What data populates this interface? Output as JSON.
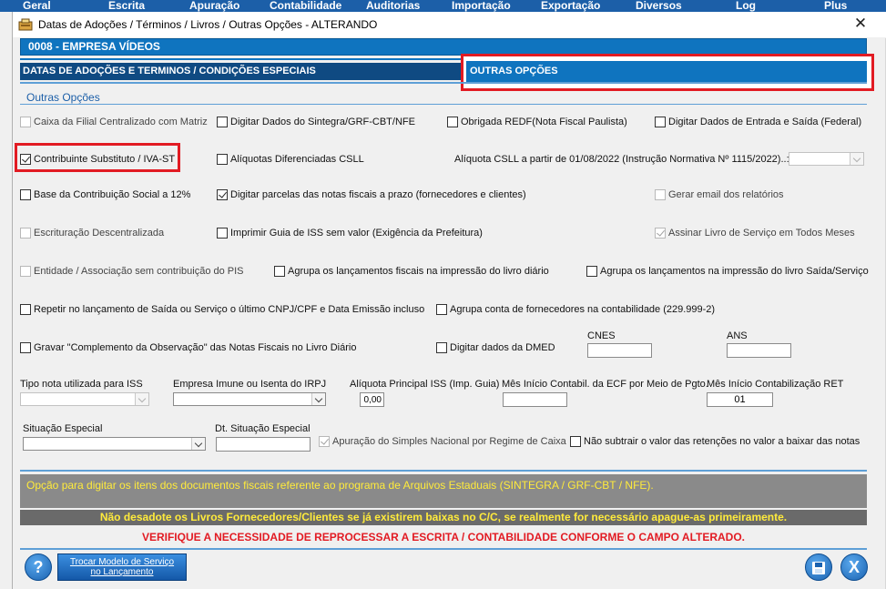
{
  "menu": [
    "Geral",
    "Escrita",
    "Apuração",
    "Contabilidade",
    "Auditorias",
    "Importação",
    "Exportação",
    "Diversos",
    "Log",
    "Plus"
  ],
  "window": {
    "title": "Datas de Adoções / Términos / Livros / Outras Opções   -   ALTERANDO",
    "close": "✕"
  },
  "company": "0008   -   EMPRESA VÍDEOS",
  "tabs": {
    "left": "DATAS DE ADOÇÕES E TERMINOS / CONDIÇÕES ESPECIAIS",
    "right": "OUTRAS OPÇÕES"
  },
  "section_title": "Outras Opções",
  "checkboxes": {
    "caixa_filial": {
      "label": "Caixa da Filial Centralizado com Matriz",
      "checked": false,
      "enabled": false
    },
    "digitar_sintegra": {
      "label": "Digitar Dados do Sintegra/GRF-CBT/NFE",
      "checked": false,
      "enabled": true
    },
    "obrigada_redf": {
      "label": "Obrigada REDF(Nota Fiscal Paulista)",
      "checked": false,
      "enabled": true
    },
    "digitar_entrada_saida": {
      "label": "Digitar Dados de Entrada e Saída (Federal)",
      "checked": false,
      "enabled": true
    },
    "contribuinte_substituto": {
      "label": "Contribuinte Substituto / IVA-ST",
      "checked": true,
      "enabled": true
    },
    "aliquotas_csll": {
      "label": "Alíquotas Diferenciadas CSLL",
      "checked": false,
      "enabled": true
    },
    "base_contribuicao": {
      "label": "Base da Contribuição Social a 12%",
      "checked": false,
      "enabled": true
    },
    "digitar_parcelas": {
      "label": "Digitar parcelas das notas fiscais a prazo (fornecedores e clientes)",
      "checked": true,
      "enabled": true
    },
    "gerar_email": {
      "label": "Gerar email dos relatórios",
      "checked": false,
      "enabled": false
    },
    "escrituracao_desc": {
      "label": "Escrituração Descentralizada",
      "checked": false,
      "enabled": false
    },
    "imprimir_guia_iss": {
      "label": "Imprimir Guia de ISS sem valor (Exigência da Prefeitura)",
      "checked": false,
      "enabled": true
    },
    "assinar_livro": {
      "label": "Assinar Livro de Serviço em Todos Meses",
      "checked": true,
      "enabled": false
    },
    "entidade_associacao": {
      "label": "Entidade / Associação sem contribuição do PIS",
      "checked": false,
      "enabled": false
    },
    "agrupa_lanc_fiscais": {
      "label": "Agrupa os lançamentos fiscais na impressão do livro diário",
      "checked": false,
      "enabled": true
    },
    "agrupa_lanc_saida": {
      "label": "Agrupa os lançamentos na impressão do livro Saída/Serviço",
      "checked": false,
      "enabled": true
    },
    "repetir_lancamento": {
      "label": "Repetir no lançamento de Saída ou Serviço o último CNPJ/CPF e Data Emissão incluso",
      "checked": false,
      "enabled": true
    },
    "agrupa_conta_fornec": {
      "label": "Agrupa conta de fornecedores na contabilidade (229.999-2)",
      "checked": false,
      "enabled": true
    },
    "gravar_complemento": {
      "label": "Gravar \"Complemento da Observação\" das Notas Fiscais no Livro Diário",
      "checked": false,
      "enabled": true
    },
    "digitar_dmed": {
      "label": "Digitar dados da DMED",
      "checked": false,
      "enabled": true
    },
    "apuracao_simples": {
      "label": "Apuração do Simples Nacional por Regime de Caixa",
      "checked": true,
      "enabled": false
    },
    "nao_subtrair": {
      "label": "Não subtrair o valor das retenções no valor a baixar das notas",
      "checked": false,
      "enabled": true
    }
  },
  "fields": {
    "aliquota_csll_label": "Alíquota CSLL a partir de 01/08/2022 (Instrução Normativa Nº 1115/2022)..:",
    "cnes_label": "CNES",
    "cnes_value": "",
    "ans_label": "ANS",
    "ans_value": "",
    "tipo_nota_label": "Tipo nota utilizada para ISS",
    "empresa_imune_label": "Empresa Imune ou Isenta do IRPJ",
    "aliquota_iss_label": "Alíquota Principal ISS (Imp. Guia)",
    "aliquota_iss_value": "0,00",
    "mes_inicio_ecf_label": "Mês Início Contabil. da ECF por Meio de Pgto.",
    "mes_inicio_ecf_value": "",
    "mes_inicio_ret_label": "Mês Início Contabilização RET",
    "mes_inicio_ret_value": "01",
    "situacao_especial_label": "Situação Especial",
    "dt_situacao_label": "Dt. Situação Especial",
    "dt_situacao_value": ""
  },
  "messages": {
    "info": "Opção para digitar os itens dos documentos fiscais referente ao programa de Arquivos Estaduais (SINTEGRA / GRF-CBT / NFE).",
    "warning": "Não desadote os Livros Fornecedores/Clientes se já existirem baixas no C/C, se realmente for necessário apague-as primeiramente.",
    "alert": "VERIFIQUE A NECESSIDADE DE REPROCESSAR A ESCRITA / CONTABILIDADE CONFORME O CAMPO ALTERADO."
  },
  "buttons": {
    "help": "?",
    "trocar_line1": "Trocar Modelo de Serviço",
    "trocar_line2": "no Lançamento",
    "exit": "X"
  },
  "colors": {
    "accent": "#0f74bf",
    "highlight": "#e21b23",
    "warning_text": "#ffeb3b"
  }
}
